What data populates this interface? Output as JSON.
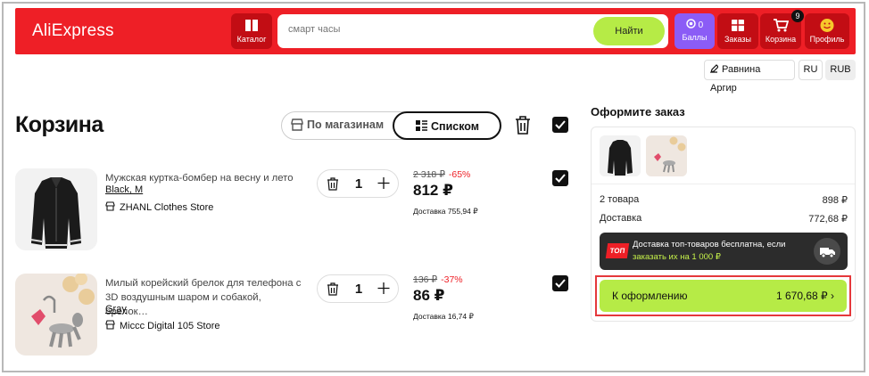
{
  "header": {
    "logo": "AliExpress",
    "catalog_label": "Каталог",
    "search_placeholder": "смарт часы",
    "search_button": "Найти",
    "points_value": "0",
    "points_label": "Баллы",
    "orders_label": "Заказы",
    "cart_label": "Корзина",
    "cart_count": "9",
    "profile_label": "Профиль",
    "brand_color": "#ee1f26",
    "accent_color": "#b6eb46"
  },
  "topbar": {
    "user_name": "Равнина Аргир",
    "language": "RU",
    "currency": "RUB"
  },
  "cart": {
    "title": "Корзина",
    "view_by_shops": "По магазинам",
    "view_list": "Списком",
    "items": [
      {
        "name": "Мужская куртка-бомбер на весну и лето",
        "variant": "Black, M",
        "store": "ZHANL Clothes Store",
        "quantity": "1",
        "old_price": "2 318 ₽",
        "discount": "-65%",
        "price": "812 ₽",
        "delivery": "Доставка 755,94 ₽",
        "checked": true
      },
      {
        "name": "Милый корейский брелок для телефона с 3D воздушным шаром и собакой, брелок…",
        "variant": "Gray",
        "store": "Miccc Digital 105 Store",
        "quantity": "1",
        "old_price": "136 ₽",
        "discount": "-37%",
        "price": "86 ₽",
        "delivery": "Доставка 16,74 ₽",
        "checked": true
      }
    ]
  },
  "summary": {
    "title": "Оформите заказ",
    "goods_label": "2 товара",
    "goods_value": "898 ₽",
    "delivery_label": "Доставка",
    "delivery_value": "772,68 ₽",
    "promo_badge": "ТОП",
    "promo_line1": "Доставка топ-товаров бесплатна, если",
    "promo_line2": "заказать их на 1 000 ₽",
    "checkout_label": "К оформлению",
    "checkout_total": "1 670,68 ₽ ›"
  }
}
